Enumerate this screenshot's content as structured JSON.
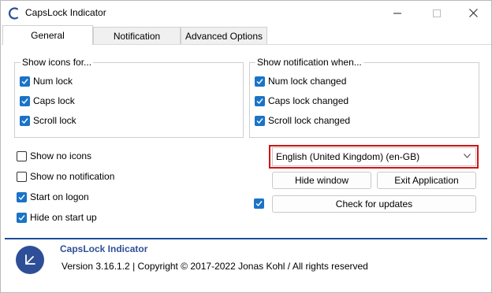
{
  "window": {
    "title": "CapsLock Indicator",
    "controls": {
      "minimize": "—",
      "maximize": "☐",
      "close": "✕"
    }
  },
  "tabs": [
    {
      "label": "General",
      "active": true
    },
    {
      "label": "Notification",
      "active": false
    },
    {
      "label": "Advanced Options",
      "active": false
    }
  ],
  "icons_group": {
    "title": "Show icons for...",
    "items": [
      {
        "label": "Num lock",
        "checked": true
      },
      {
        "label": "Caps lock",
        "checked": true
      },
      {
        "label": "Scroll lock",
        "checked": true
      }
    ]
  },
  "notif_group": {
    "title": "Show notification when...",
    "items": [
      {
        "label": "Num lock changed",
        "checked": true
      },
      {
        "label": "Caps lock changed",
        "checked": true
      },
      {
        "label": "Scroll lock changed",
        "checked": true
      }
    ]
  },
  "options": [
    {
      "label": "Show no icons",
      "checked": false
    },
    {
      "label": "Show no notification",
      "checked": false
    },
    {
      "label": "Start on logon",
      "checked": true
    },
    {
      "label": "Hide on start up",
      "checked": true
    }
  ],
  "language_select": {
    "value": "English (United Kingdom) (en-GB)"
  },
  "buttons": {
    "hide_window": "Hide window",
    "exit_application": "Exit Application",
    "check_updates": "Check for updates"
  },
  "check_updates_checkbox": {
    "checked": true
  },
  "about": {
    "name": "CapsLock Indicator",
    "version": "Version 3.16.1.2 | Copyright © 2017-2022 Jonas Kohl / All rights reserved"
  },
  "colors": {
    "accent": "#1a73c7",
    "brand": "#2e4f97",
    "highlight": "#d01414"
  }
}
